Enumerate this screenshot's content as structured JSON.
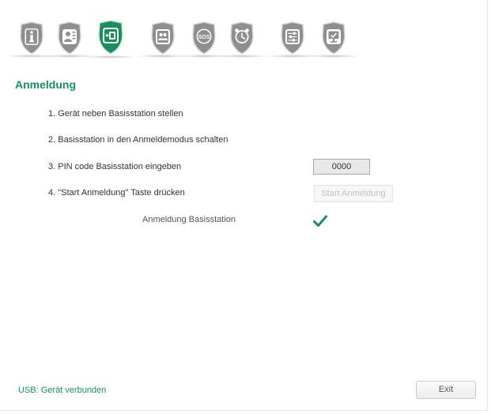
{
  "toolbar": {
    "items": [
      {
        "icon": "info-icon",
        "active": false
      },
      {
        "icon": "contact-card-icon",
        "active": false
      },
      {
        "icon": "add-device-icon",
        "active": true
      },
      {
        "icon": "contacts-book-icon",
        "active": false
      },
      {
        "icon": "sos-icon",
        "active": false,
        "label": "SOS"
      },
      {
        "icon": "alarm-clock-icon",
        "active": false
      },
      {
        "icon": "settings-sliders-icon",
        "active": false
      },
      {
        "icon": "monitor-icon",
        "active": false
      }
    ],
    "colors": {
      "inactive": "#8c8c8c",
      "active": "#1a8f5e"
    }
  },
  "page": {
    "title": "Anmeldung",
    "steps": [
      "1. Gerät neben Basisstation stellen",
      "2. Basisstation in den Anmeldemodus schalten",
      "3. PIN code Basisstation eingeben",
      "4. \"Start Anmeldung\" Taste drücken"
    ],
    "pin_value": "0000",
    "start_button_label": "Start Anmeldung",
    "registration_label": "Anmeldung Basisstation",
    "registration_status": "check-icon"
  },
  "footer": {
    "usb_status": "USB: Gerät verbunden",
    "exit_label": "Exit"
  },
  "colors": {
    "accent": "#1a8f5e"
  }
}
